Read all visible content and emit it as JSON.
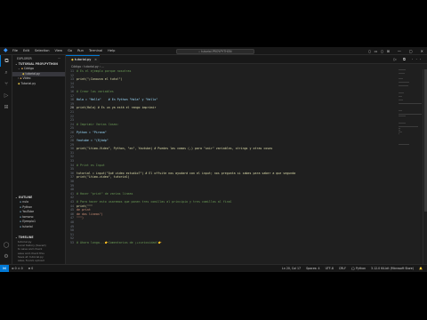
{
  "titlebar": {
    "menus": [
      "File",
      "Edit",
      "Selection",
      "View",
      "Go",
      "Run",
      "Terminal",
      "Help"
    ],
    "search": "tutorial.PROY.PYTHON",
    "window_controls": [
      "—",
      "▢",
      "✕"
    ]
  },
  "sidebar": {
    "header": "EXPLORER",
    "header_more": "···",
    "project": "TUTORIAL PROY.PYTHON",
    "tree": [
      {
        "label": "Código",
        "type": "folder",
        "icon": "folder-icon"
      },
      {
        "label": "tutorial.py",
        "type": "file",
        "icon": "python-file-icon",
        "selected": true
      },
      {
        "label": "Video",
        "type": "folder",
        "icon": "folder-icon"
      },
      {
        "label": "Tutorial.py",
        "type": "file",
        "icon": "python-file-icon"
      }
    ],
    "outline": {
      "header": "OUTLINE",
      "items": [
        "nulo",
        "Python",
        "YouTube",
        "tomono",
        "Ejemplo1",
        "tutorial"
      ]
    },
    "timeline": {
      "header": "TIMELINE",
      "items": [
        "tutorial.py",
        "Local history (Saved)",
        "to save and check",
        "save and check this",
        "Save at: tutorial.py",
        "save, found, upload"
      ]
    }
  },
  "editor": {
    "tab": {
      "label": "tutorial.py",
      "close": "×"
    },
    "tab_actions": "▷ ⧉ ···",
    "breadcrumb": "Código  ›  tutorial.py  ›  ...",
    "lines": [
      {
        "n": "11",
        "text": "# Es el ejemplo porque nosotras",
        "kind": "comment"
      },
      {
        "n": "12",
        "text": "",
        "kind": "plain"
      },
      {
        "n": "13",
        "text": "print(\"¡Conozca el tuto!\")",
        "kind": "call"
      },
      {
        "n": "14",
        "text": "",
        "kind": "plain"
      },
      {
        "n": "15",
        "text": "",
        "kind": "plain"
      },
      {
        "n": "16",
        "text": "# Crear las variables",
        "kind": "comment"
      },
      {
        "n": "17",
        "text": "",
        "kind": "plain"
      },
      {
        "n": "18",
        "text": "Hola = \"Hello\"    # En Python \"Hola\" y \"Hello\"",
        "kind": "assign"
      },
      {
        "n": "19",
        "text": "",
        "kind": "plain"
      },
      {
        "n": "20",
        "text": "print(Hola) # Es un ya está el rango imprimir",
        "kind": "call"
      },
      {
        "n": "21",
        "text": "",
        "kind": "plain"
      },
      {
        "n": "22",
        "text": "",
        "kind": "plain"
      },
      {
        "n": "23",
        "text": "",
        "kind": "plain"
      },
      {
        "n": "24",
        "text": "# Imprimir Varias Cosas:",
        "kind": "comment"
      },
      {
        "n": "25",
        "text": "",
        "kind": "plain"
      },
      {
        "n": "26",
        "text": "Python = \"Pirana\"",
        "kind": "assign"
      },
      {
        "n": "27",
        "text": "",
        "kind": "plain"
      },
      {
        "n": "28",
        "text": "Youtube = \"(Ejbdp\"",
        "kind": "assign"
      },
      {
        "n": "29",
        "text": "",
        "kind": "plain"
      },
      {
        "n": "30",
        "text": "print(\"Ltimo-Video\", Python, \"en\", Youtube) # Puedes las comas (,) para \"unir\" variables, strings y otras cosas",
        "kind": "call"
      },
      {
        "n": "31",
        "text": "",
        "kind": "plain"
      },
      {
        "n": "32",
        "text": "",
        "kind": "plain"
      },
      {
        "n": "33",
        "text": "",
        "kind": "plain"
      },
      {
        "n": "34",
        "text": "# Print es Input",
        "kind": "comment"
      },
      {
        "n": "35",
        "text": "",
        "kind": "plain"
      },
      {
        "n": "36",
        "text": "tutorial = input(\"Qué video estudio?\") # El offsite nos ayudará con el input; nos pregunta si sabes para saber a que segunda",
        "kind": "call"
      },
      {
        "n": "37",
        "text": "print(\"Ltimo-video\", tutorial)",
        "kind": "call"
      },
      {
        "n": "38",
        "text": "",
        "kind": "plain"
      },
      {
        "n": "39",
        "text": "",
        "kind": "plain"
      },
      {
        "n": "40",
        "text": "",
        "kind": "plain"
      },
      {
        "n": "41",
        "text": "# Hacer \"print\" de varias líneas",
        "kind": "comment"
      },
      {
        "n": "42",
        "text": "",
        "kind": "plain"
      },
      {
        "n": "43",
        "text": "# Para hacer esto usaremos que ponen tres comillas al principio y tres comillas al final",
        "kind": "comment"
      },
      {
        "n": "44",
        "text": "print(\"\"\"",
        "kind": "call"
      },
      {
        "n": "45",
        "text": "de print",
        "kind": "str"
      },
      {
        "n": "46",
        "text": "de dos líneas\")",
        "kind": "str"
      },
      {
        "n": "47",
        "text": "\"\"\")",
        "kind": "str"
      },
      {
        "n": "48",
        "text": "",
        "kind": "plain"
      },
      {
        "n": "49",
        "text": "",
        "kind": "plain"
      },
      {
        "n": "50",
        "text": "",
        "kind": "plain"
      },
      {
        "n": "51",
        "text": "",
        "kind": "plain"
      },
      {
        "n": "52",
        "text": "",
        "kind": "plain"
      },
      {
        "n": "53",
        "text": "# Ahora longo...👉Comentarios de ¡+curiosidad!👉",
        "kind": "comment"
      }
    ],
    "current_line": "20"
  },
  "statusbar": {
    "left": [
      "⊗ 0 ⚠ 0",
      "⊕ 0"
    ],
    "right": [
      "Ln 20, Col 17",
      "Spaces: 4",
      "UTF-8",
      "CRLF",
      "{} Python",
      "3.12.0 64-bit (Microsoft Store)",
      "🔔"
    ]
  }
}
